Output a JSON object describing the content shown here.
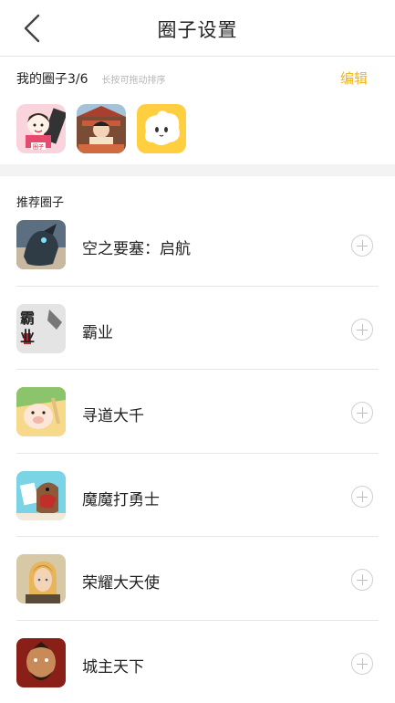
{
  "header": {
    "title": "圈子设置",
    "back_icon": "chevron-left-icon"
  },
  "my_circles": {
    "title": "我的圈子3/6",
    "hint": "长按可拖动排序",
    "edit_label": "编辑",
    "icons": [
      {
        "name": "pink-character-circle",
        "accent": "#f4b5c5",
        "glyph": "圈子"
      },
      {
        "name": "noodle-shop-circle",
        "accent": "#8a5a44",
        "glyph": ""
      },
      {
        "name": "white-blob-circle",
        "accent": "#ffcf3f",
        "glyph": ""
      }
    ]
  },
  "recommended": {
    "title": "推荐圈子",
    "items": [
      {
        "label": "空之要塞：启航",
        "accent": "#4a5b6a"
      },
      {
        "label": "霸业",
        "accent": "#d9d9d9",
        "glyph": "霸业"
      },
      {
        "label": "寻道大千",
        "accent": "#f5d07a"
      },
      {
        "label": "魔魔打勇士",
        "accent": "#6fd0e0"
      },
      {
        "label": "荣耀大天使",
        "accent": "#cdb48a"
      },
      {
        "label": "城主天下",
        "accent": "#9a2a1e"
      }
    ]
  },
  "colors": {
    "accent": "#f0b41e",
    "divider": "#e6e6e6",
    "band": "#f3f3f3"
  }
}
